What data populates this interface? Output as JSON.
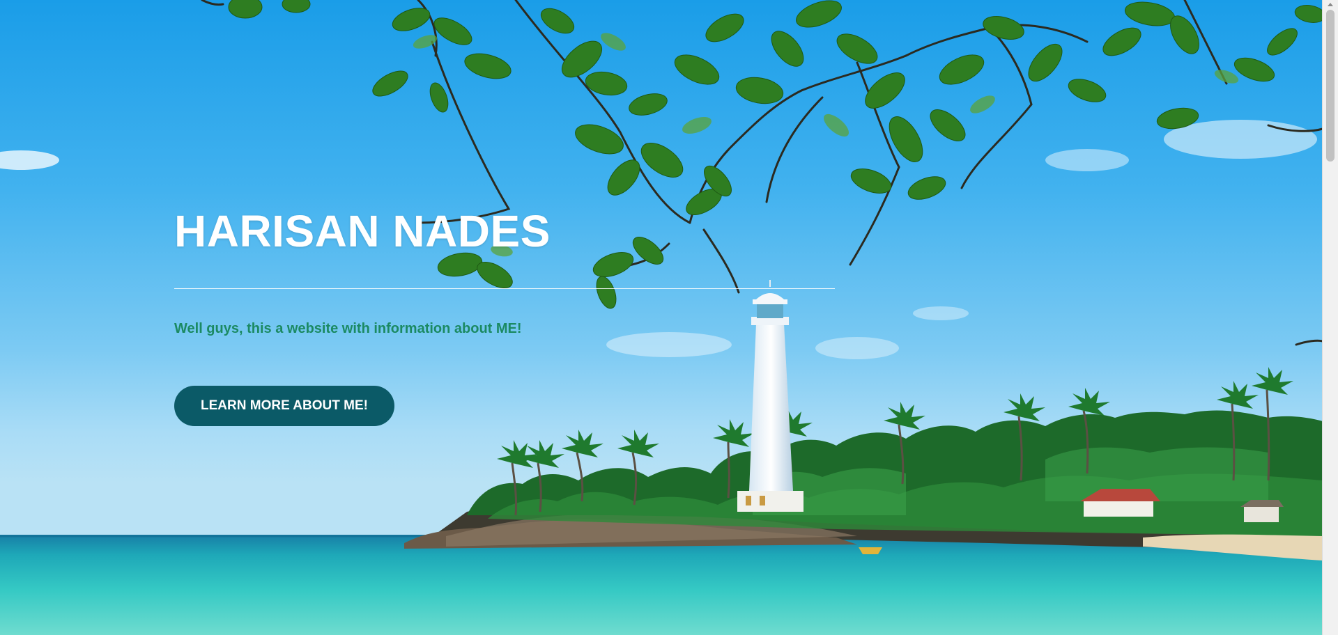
{
  "hero": {
    "title": "HARISAN NADES",
    "subtitle": "Well guys, this a website with information about ME!",
    "button_label": "LEARN MORE ABOUT ME!",
    "background_image": "tropical-beach-lighthouse-photo"
  },
  "colors": {
    "sky": "#42b2ef",
    "sea": "#2fc2c2",
    "title": "#ffffff",
    "subtitle": "#1b8a63",
    "button": "#0b5a67"
  }
}
